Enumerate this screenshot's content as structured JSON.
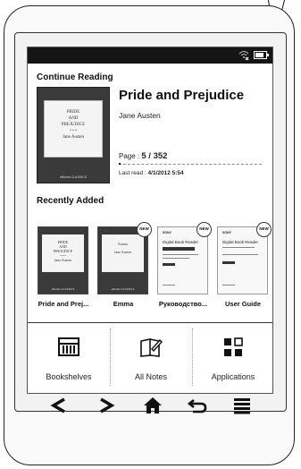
{
  "status_bar": {
    "wifi_icon": "wifi-off-icon",
    "battery_icon": "battery-icon",
    "battery_level": 0.85
  },
  "continue_reading": {
    "section_title": "Continue Reading",
    "cover": {
      "line1": "PRIDE",
      "line2": "AND",
      "line3": "PREJUDICE",
      "ornament": "• • •",
      "author": "Jane Austen",
      "publisher": "eBooks CLASSICS"
    },
    "title": "Pride and Prejudice",
    "author": "Jane Austen",
    "page_label": "Page :",
    "page_value": "5 / 352",
    "progress": 0.014,
    "last_read_label": "Last read :",
    "last_read_value": "4/1/2012 5:54"
  },
  "recently_added": {
    "section_title": "Recently Added",
    "new_badge": "NEW",
    "items": [
      {
        "label": "Pride and Prej...",
        "cover_lines": [
          "PRIDE",
          "AND",
          "PREJUDICE",
          "• • •",
          "Jane Austen"
        ],
        "publisher": "eBooks CLASSICS",
        "is_new": false
      },
      {
        "label": "Emma",
        "cover_lines": [
          "Emma",
          "Jane Austen"
        ],
        "publisher": "eBooks CLASSICS",
        "is_new": true
      },
      {
        "label": "Руководство...",
        "brand": "SONY",
        "doc_title": "Digital Book Reader",
        "is_new": true
      },
      {
        "label": "User Guide",
        "brand": "SONY",
        "doc_title": "Digital Book Reader",
        "is_new": true
      }
    ]
  },
  "app_bar": [
    {
      "label": "Bookshelves",
      "icon": "bookshelves-icon"
    },
    {
      "label": "All Notes",
      "icon": "notes-icon"
    },
    {
      "label": "Applications",
      "icon": "applications-icon"
    }
  ],
  "hardware_buttons": [
    "back-arrow-icon",
    "forward-arrow-icon",
    "home-icon",
    "return-icon",
    "menu-icon"
  ]
}
